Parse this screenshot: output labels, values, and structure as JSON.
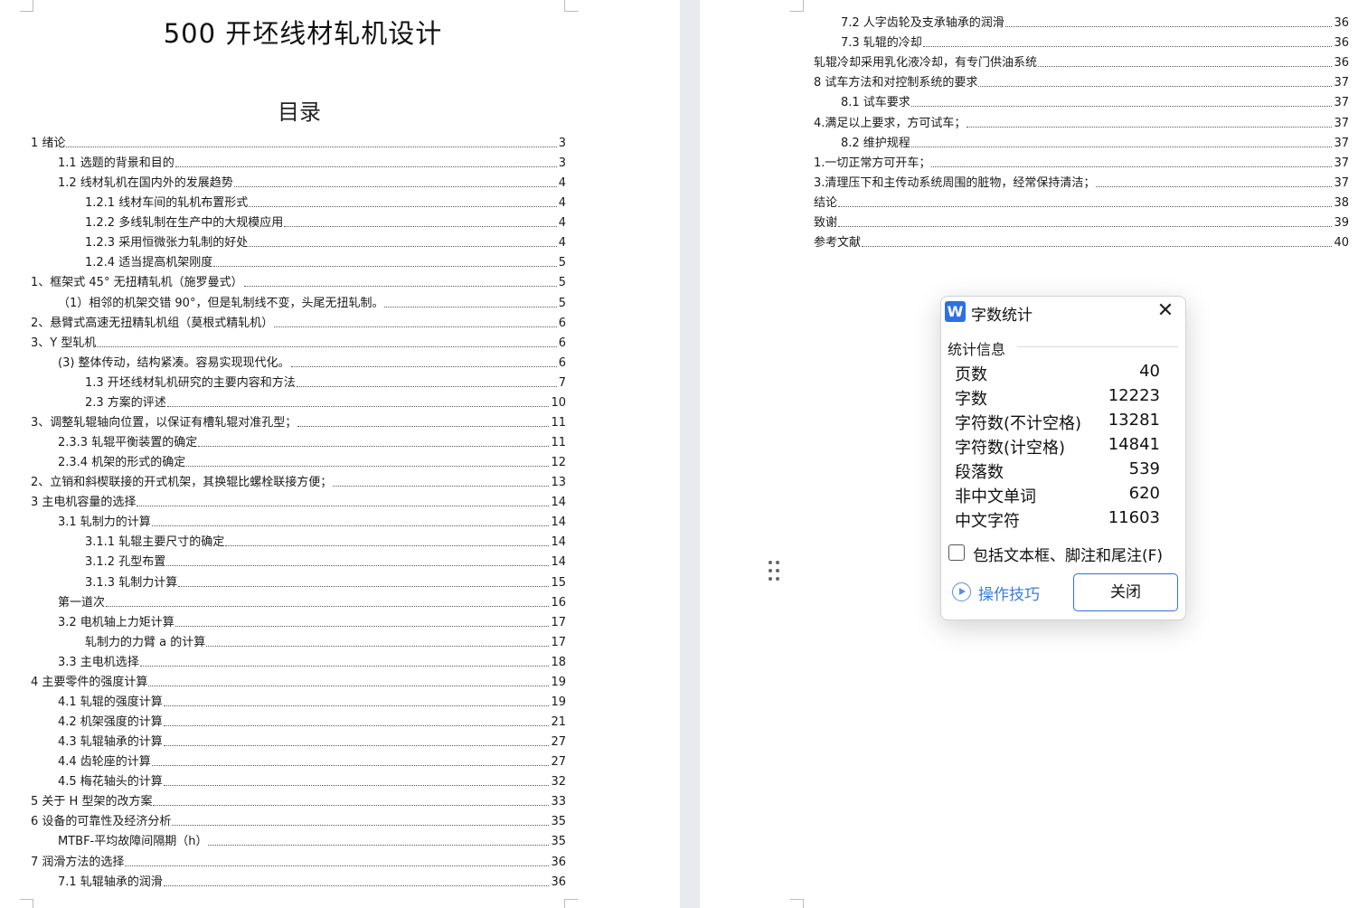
{
  "document": {
    "title": "500 开坯线材轧机设计",
    "toc_heading": "目录"
  },
  "toc_left": [
    {
      "text": "1 绪论",
      "page": "3"
    },
    {
      "text": "1.1 选题的背景和目的",
      "page": "3"
    },
    {
      "text": "1.2 线材轧机在国内外的发展趋势",
      "page": "4"
    },
    {
      "text": "1.2.1 线材车间的轧机布置形式",
      "page": "4"
    },
    {
      "text": "1.2.2 多线轧制在生产中的大规模应用",
      "page": "4"
    },
    {
      "text": "1.2.3 采用恒微张力轧制的好处",
      "page": "4"
    },
    {
      "text": "1.2.4 适当提高机架刚度",
      "page": "5"
    },
    {
      "text": "1、框架式 45° 无扭精轧机（施罗曼式）",
      "page": "5"
    },
    {
      "text": "（1）相邻的机架交错 90°，但是轧制线不变，头尾无扭轧制。",
      "page": "5"
    },
    {
      "text": "2、悬臂式高速无扭精轧机组（莫根式精轧机）",
      "page": "6"
    },
    {
      "text": "3、Y 型轧机",
      "page": "6"
    },
    {
      "text": "(3) 整体传动，结构紧凑。容易实现现代化。",
      "page": "6"
    },
    {
      "text": "1.3 开坯线材轧机研究的主要内容和方法",
      "page": "7"
    },
    {
      "text": "2.3 方案的评述",
      "page": "10"
    },
    {
      "text": "3、调整轧辊轴向位置，以保证有槽轧辊对准孔型；",
      "page": "11"
    },
    {
      "text": "2.3.3 轧辊平衡装置的确定",
      "page": "11"
    },
    {
      "text": "2.3.4 机架的形式的确定",
      "page": "12"
    },
    {
      "text": "2、立销和斜楔联接的开式机架，其换辊比螺栓联接方便；",
      "page": "13"
    },
    {
      "text": "3 主电机容量的选择",
      "page": "14"
    },
    {
      "text": "3.1 轧制力的计算",
      "page": "14"
    },
    {
      "text": "3.1.1 轧辊主要尺寸的确定",
      "page": "14"
    },
    {
      "text": "3.1.2 孔型布置",
      "page": "14"
    },
    {
      "text": "3.1.3 轧制力计算",
      "page": "15"
    },
    {
      "text": "第一道次",
      "page": "16"
    },
    {
      "text": "3.2 电机轴上力矩计算",
      "page": "17"
    },
    {
      "text": "轧制力的力臂 a 的计算",
      "page": "17"
    },
    {
      "text": "3.3 主电机选择",
      "page": "18"
    },
    {
      "text": "4 主要零件的强度计算",
      "page": "19"
    },
    {
      "text": "4.1 轧辊的强度计算",
      "page": "19"
    },
    {
      "text": "4.2 机架强度的计算",
      "page": "21"
    },
    {
      "text": "4.3 轧辊轴承的计算",
      "page": "27"
    },
    {
      "text": "4.4 齿轮座的计算",
      "page": "27"
    },
    {
      "text": "4.5 梅花轴头的计算",
      "page": "32"
    },
    {
      "text": "5 关于 H 型架的改方案",
      "page": "33"
    },
    {
      "text": "6 设备的可靠性及经济分析",
      "page": "35"
    },
    {
      "text": "MTBF-平均故障间隔期（h）",
      "page": "35"
    },
    {
      "text": "7 润滑方法的选择",
      "page": "36"
    },
    {
      "text": "7.1 轧辊轴承的润滑",
      "page": "36"
    }
  ],
  "toc_right": [
    {
      "text": "7.2 人字齿轮及支承轴承的润滑",
      "page": "36"
    },
    {
      "text": "7.3 轧辊的冷却",
      "page": "36"
    },
    {
      "text": "轧辊冷却采用乳化液冷却，有专门供油系统",
      "page": "36"
    },
    {
      "text": "8 试车方法和对控制系统的要求",
      "page": "37"
    },
    {
      "text": "8.1 试车要求",
      "page": "37"
    },
    {
      "text": "4.满足以上要求，方可试车；",
      "page": "37"
    },
    {
      "text": "8.2 维护规程",
      "page": "37"
    },
    {
      "text": "1.一切正常方可开车；",
      "page": "37"
    },
    {
      "text": "3.清理压下和主传动系统周围的脏物，经常保持清洁；",
      "page": "37"
    },
    {
      "text": "结论",
      "page": "38"
    },
    {
      "text": "致谢",
      "page": "39"
    },
    {
      "text": "参考文献",
      "page": "40"
    }
  ],
  "dialog": {
    "app_icon": "W",
    "title": "字数统计",
    "section": "统计信息",
    "stats": [
      {
        "label": "页数",
        "value": "40"
      },
      {
        "label": "字数",
        "value": "12223"
      },
      {
        "label": "字符数(不计空格)",
        "value": "13281"
      },
      {
        "label": "字符数(计空格)",
        "value": "14841"
      },
      {
        "label": "段落数",
        "value": "539"
      },
      {
        "label": "非中文单词",
        "value": "620"
      },
      {
        "label": "中文字符",
        "value": "11603"
      }
    ],
    "checkbox_label": "包括文本框、脚注和尾注(F)",
    "checkbox_checked": false,
    "tips_label": "操作技巧",
    "close_label": "关闭",
    "accent_color": "#2f6fe6"
  }
}
